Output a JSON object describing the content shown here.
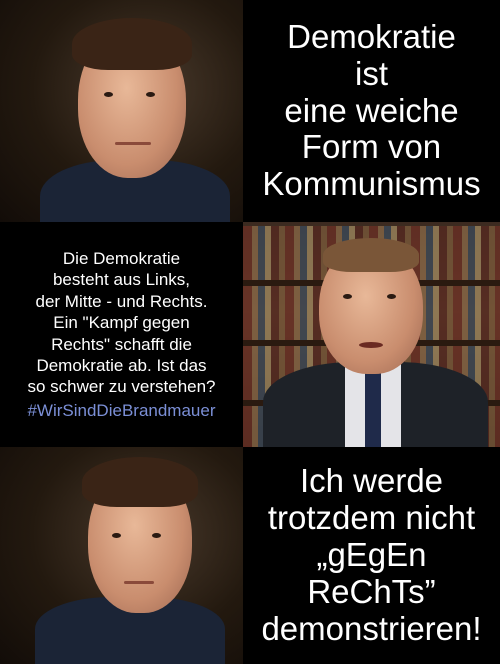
{
  "panel_top_right_text": "Demokratie\nist\neine weiche\nForm von\nKommunismus",
  "panel_middle_left_text": "Die Demokratie\nbesteht aus Links,\nder Mitte - und Rechts.\nEin \"Kampf gegen\nRechts\" schafft die\nDemokratie ab. Ist das\nso schwer zu verstehen?",
  "panel_middle_left_hashtag": "#WirSindDieBrandmauer",
  "panel_bottom_right_text": "Ich werde\ntrotzdem nicht\n„gEgEn\nReChTs”\ndemonstrieren!",
  "colors": {
    "background": "#000000",
    "text": "#ffffff",
    "hashtag": "#7b8fd6"
  }
}
